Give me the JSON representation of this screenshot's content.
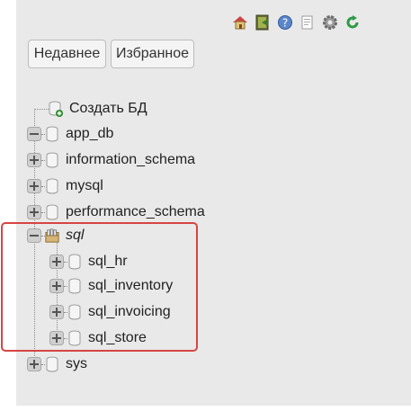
{
  "toolbar": {
    "icons": [
      "home-icon",
      "logout-icon",
      "help-icon",
      "docs-icon",
      "settings-icon",
      "reload-icon"
    ]
  },
  "tabs": {
    "recent": "Недавнее",
    "favorites": "Избранное"
  },
  "tree": {
    "create_db": "Создать БД",
    "databases": {
      "app_db": "app_db",
      "information_schema": "information_schema",
      "mysql": "mysql",
      "performance_schema": "performance_schema",
      "sql": "sql",
      "sys": "sys"
    },
    "sql_children": {
      "sql_hr": "sql_hr",
      "sql_inventory": "sql_inventory",
      "sql_invoicing": "sql_invoicing",
      "sql_store": "sql_store"
    }
  },
  "colors": {
    "panel_bg": "#e9e9e9",
    "highlight": "#d64541"
  }
}
